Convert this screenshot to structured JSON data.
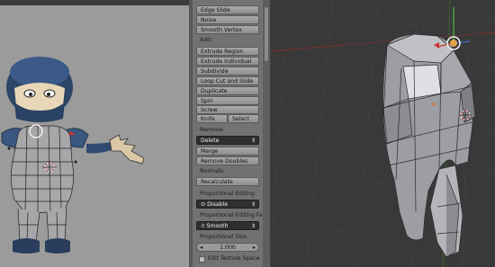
{
  "tools": {
    "edge_slide": "Edge Slide",
    "noise": "Noise",
    "smooth_vertex": "Smooth Vertex",
    "add_label": "Add:",
    "extrude_region": "Extrude Region",
    "extrude_individual": "Extrude Individual",
    "subdivide": "Subdivide",
    "loop_cut": "Loop Cut and Slide",
    "duplicate": "Duplicate",
    "spin": "Spin",
    "screw": "Screw",
    "knife": "Knife",
    "select": "Select",
    "remove_label": "Remove:",
    "delete": "Delete",
    "merge": "Merge",
    "remove_doubles": "Remove Doubles",
    "normals_label": "Normals:",
    "recalculate": "Recalculate",
    "prop_edit_label": "Proportional Editing",
    "prop_edit_value": "Disable",
    "prop_falloff_label": "Proportional Editing Fall",
    "prop_falloff_value": "Smooth",
    "prop_size_label": "Proportional Size",
    "prop_size_value": "1.000",
    "edit_texture_space": "Edit Texture Space"
  },
  "icons": {
    "dropdown": "up-down-arrows-icon",
    "decrement": "left-arrow-icon",
    "increment": "right-arrow-icon"
  },
  "colors": {
    "panel_bg": "#727272",
    "viewport_bg": "#393939",
    "reference_bg": "#9a9a9a",
    "dropdown_bg": "#2f2f2f",
    "axis_red": "#d03030",
    "axis_green": "#40b040",
    "axis_blue": "#3a6cd8",
    "mesh": "#a9aab0"
  },
  "prop_editing_enabled": false,
  "edit_texture_space_checked": false
}
